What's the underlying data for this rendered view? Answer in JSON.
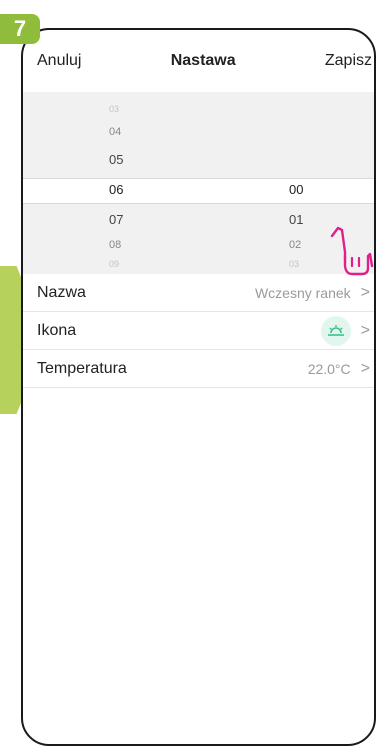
{
  "step_number": "7",
  "header": {
    "cancel_label": "Anuluj",
    "title": "Nastawa",
    "save_label": "Zapisz"
  },
  "picker": {
    "hours": [
      "03",
      "04",
      "05",
      "06",
      "07",
      "08",
      "09"
    ],
    "minutes": [
      "00",
      "01",
      "02",
      "03"
    ],
    "selected_hour": "06",
    "selected_minute": "00"
  },
  "settings": {
    "name": {
      "label": "Nazwa",
      "value": "Wczesny ranek"
    },
    "icon": {
      "label": "Ikona",
      "icon_name": "sunrise-icon"
    },
    "temperature": {
      "label": "Temperatura",
      "value": "22.0°C"
    }
  },
  "colors": {
    "step_badge": "#8fbc3a",
    "arrow": "#b6d25c",
    "hand": "#e0208a",
    "icon_bg": "#e3f5ef",
    "icon_fg": "#3cc08a"
  }
}
